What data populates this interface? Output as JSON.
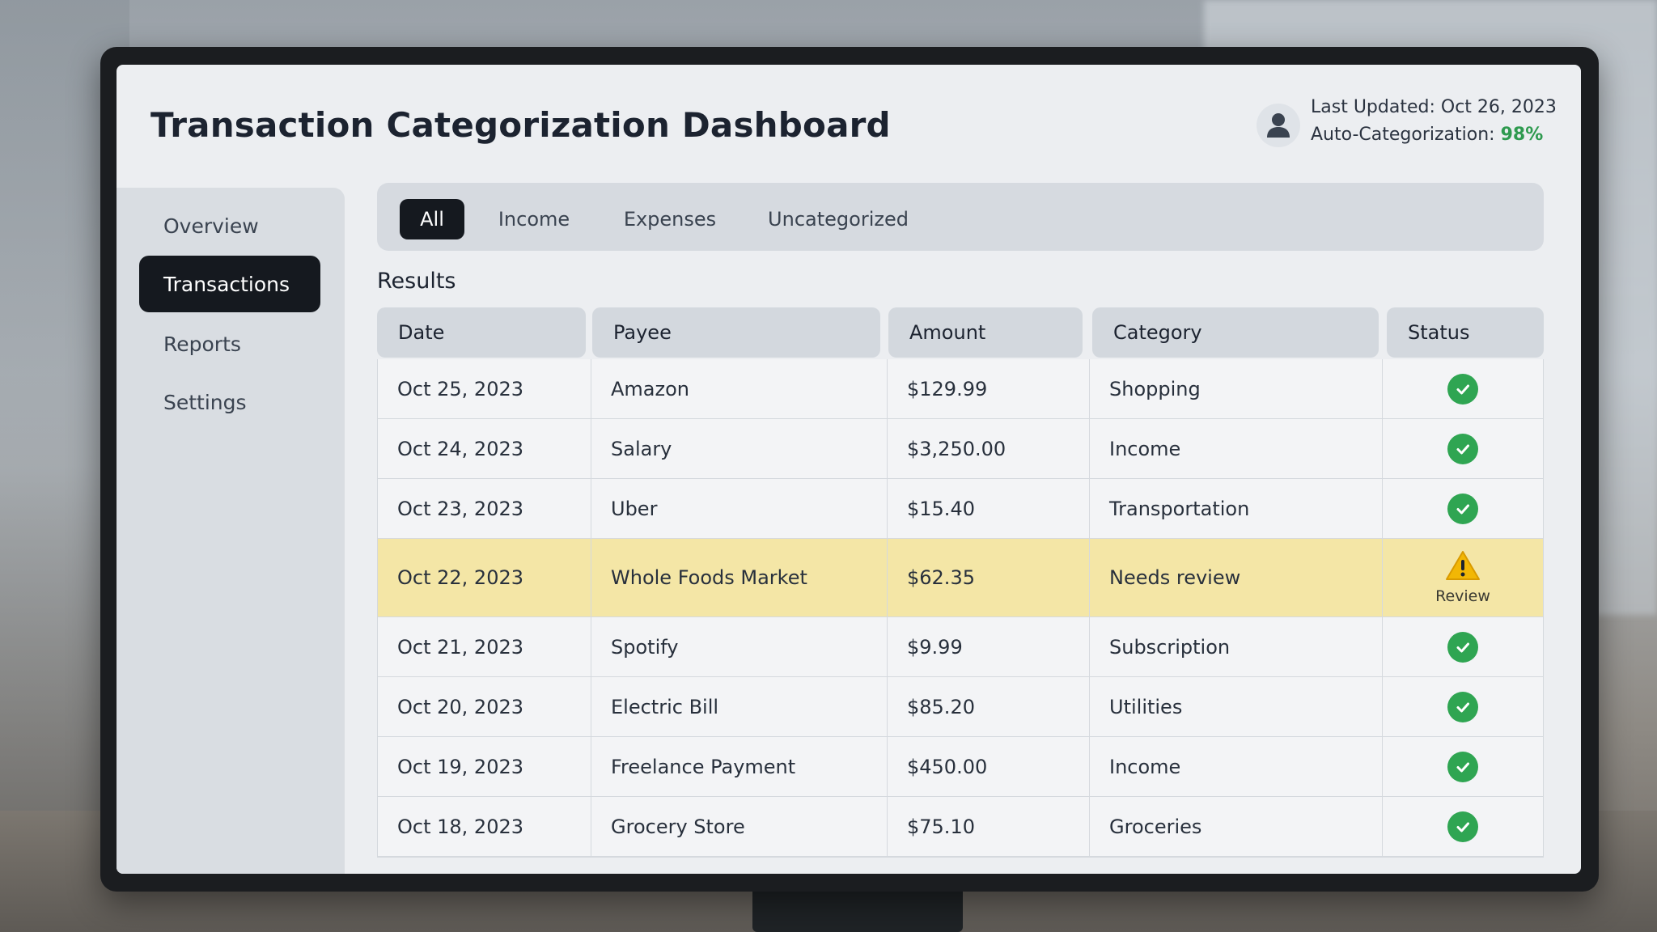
{
  "header": {
    "title": "Transaction Categorization Dashboard",
    "last_updated_label": "Last Updated:",
    "last_updated_value": "Oct 26, 2023",
    "auto_cat_label": "Auto-Categorization:",
    "auto_cat_value": "98%"
  },
  "sidebar": {
    "items": [
      {
        "label": "Overview",
        "active": false
      },
      {
        "label": "Transactions",
        "active": true
      },
      {
        "label": "Reports",
        "active": false
      },
      {
        "label": "Settings",
        "active": false
      }
    ]
  },
  "filters": {
    "tabs": [
      {
        "label": "All",
        "active": true
      },
      {
        "label": "Income",
        "active": false
      },
      {
        "label": "Expenses",
        "active": false
      },
      {
        "label": "Uncategorized",
        "active": false
      }
    ]
  },
  "results_label": "Results",
  "table": {
    "columns": [
      "Date",
      "Payee",
      "Amount",
      "Category",
      "Status"
    ],
    "rows": [
      {
        "date": "Oct 25, 2023",
        "payee": "Amazon",
        "amount": "$129.99",
        "category": "Shopping",
        "status": "check-icon"
      },
      {
        "date": "Oct 24, 2023",
        "payee": "Salary",
        "amount": "$3,250.00",
        "category": "Income",
        "status": "check-icon"
      },
      {
        "date": "Oct 23, 2023",
        "payee": "Uber",
        "amount": "$15.40",
        "category": "Transportation",
        "status": "check-icon"
      },
      {
        "date": "Oct 22, 2023",
        "payee": "Whole Foods Market",
        "amount": "$62.35",
        "category": "Needs review",
        "status": "warning-icon",
        "status_label": "Review"
      },
      {
        "date": "Oct 21, 2023",
        "payee": "Spotify",
        "amount": "$9.99",
        "category": "Subscription",
        "status": "check-icon"
      },
      {
        "date": "Oct 20, 2023",
        "payee": "Electric Bill",
        "amount": "$85.20",
        "category": "Utilities",
        "status": "check-icon"
      },
      {
        "date": "Oct 19, 2023",
        "payee": "Freelance Payment",
        "amount": "$450.00",
        "category": "Income",
        "status": "check-icon"
      },
      {
        "date": "Oct 18, 2023",
        "payee": "Grocery Store",
        "amount": "$75.10",
        "category": "Groceries",
        "status": "check-icon"
      }
    ]
  },
  "colors": {
    "accent_dark": "#15191f",
    "success": "#2fa552",
    "review_highlight": "#f4e6a6",
    "warning": "#f2b705"
  }
}
